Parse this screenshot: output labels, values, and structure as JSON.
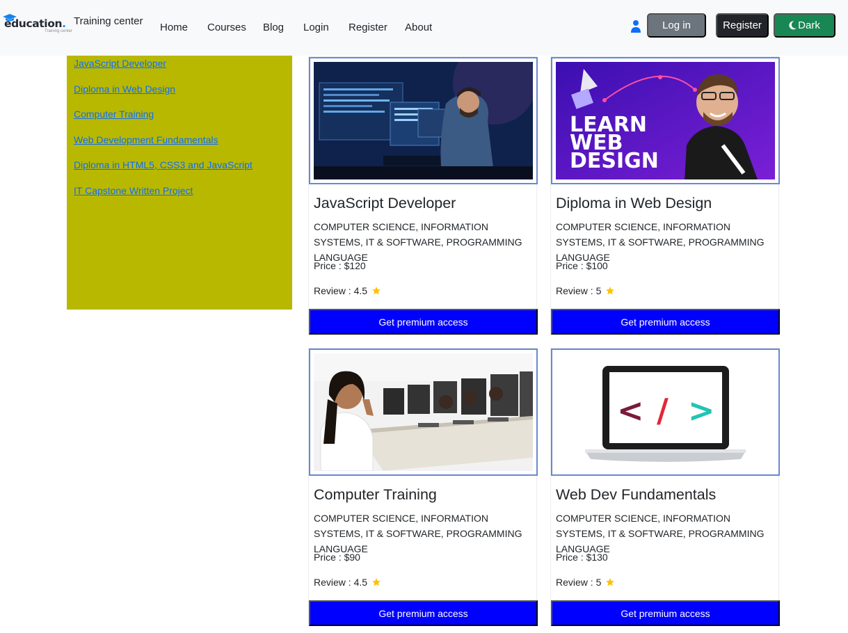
{
  "header": {
    "brand": {
      "name": "education",
      "dot": ".",
      "subtitle": "Training center"
    },
    "tagline": "Training center",
    "nav": [
      "Home",
      "Courses",
      "Blog",
      "Login",
      "Register",
      "About"
    ],
    "login_label": "Log in",
    "register_label": "Register",
    "theme_label": "Dark"
  },
  "sidebar": {
    "links": [
      "JavaScript Developer",
      "Diploma in Web Design",
      "Computer Training",
      "Web Development Fundamentals",
      "Diploma in HTML5, CSS3 and JavaScript",
      "IT Capstone Written Project"
    ]
  },
  "courses": [
    {
      "title": "JavaScript Developer",
      "category": "COMPUTER SCIENCE, INFORMATION SYSTEMS, IT & SOFTWARE, PROGRAMMING LANGUAGE",
      "price": "Price : $120",
      "review": "Review : 4.5",
      "button": "Get premium access"
    },
    {
      "title": "Diploma in Web Design",
      "category": "COMPUTER SCIENCE, INFORMATION SYSTEMS, IT & SOFTWARE, PROGRAMMING LANGUAGE",
      "price": "Price : $100",
      "review": "Review : 5",
      "button": "Get premium access",
      "image_text": [
        "LEARN",
        "WEB",
        "DESIGN"
      ]
    },
    {
      "title": "Computer Training",
      "category": "COMPUTER SCIENCE, INFORMATION SYSTEMS, IT & SOFTWARE, PROGRAMMING LANGUAGE",
      "price": "Price : $90",
      "review": "Review : 4.5",
      "button": "Get premium access"
    },
    {
      "title": "Web Dev Fundamentals",
      "category": "COMPUTER SCIENCE, INFORMATION SYSTEMS, IT & SOFTWARE, PROGRAMMING LANGUAGE",
      "price": "Price : $130",
      "review": "Review : 5",
      "button": "Get premium access",
      "image_text": [
        "<",
        "/",
        ">"
      ]
    }
  ],
  "colors": {
    "navbar_bg": "#f8f9fa",
    "sidebar_bg": "#b8b800",
    "link": "#0d6efd",
    "card_button": "#0000ff",
    "image_border": "#6a87d4",
    "star": "#ffc107",
    "login_button": "#6c757d",
    "register_button": "#212529",
    "dark_button": "#198754"
  },
  "icons": {
    "brand": "graduation-cap-icon",
    "user": "user-icon",
    "theme": "moon-icon",
    "rating": "star-icon"
  }
}
